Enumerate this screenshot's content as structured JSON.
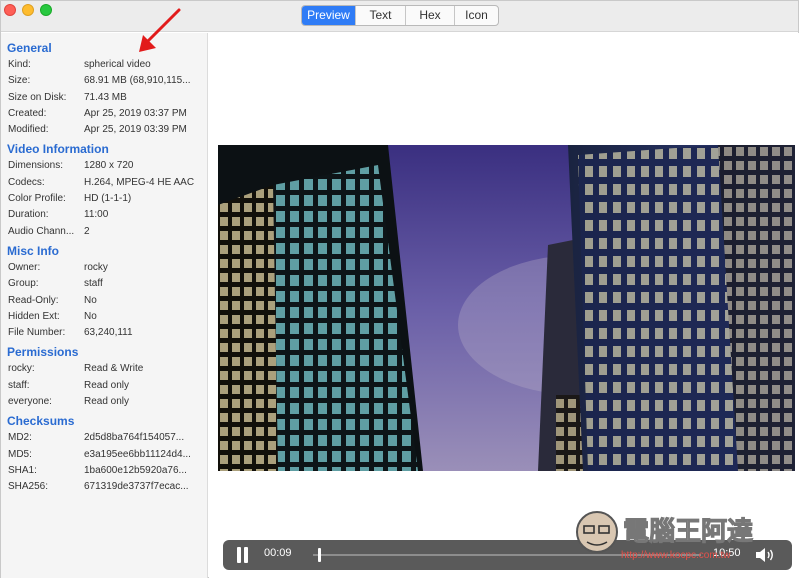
{
  "tabs": [
    {
      "label": "Preview",
      "active": true
    },
    {
      "label": "Text",
      "active": false
    },
    {
      "label": "Hex",
      "active": false
    },
    {
      "label": "Icon",
      "active": false
    }
  ],
  "sections": [
    {
      "title": "General",
      "rows": [
        {
          "k": "Kind:",
          "v": "spherical video"
        },
        {
          "k": "Size:",
          "v": "68.91 MB (68,910,115..."
        },
        {
          "k": "Size on Disk:",
          "v": "71.43 MB"
        },
        {
          "k": "Created:",
          "v": "Apr 25, 2019 03:37 PM"
        },
        {
          "k": "Modified:",
          "v": "Apr 25, 2019 03:39 PM"
        }
      ]
    },
    {
      "title": "Video Information",
      "rows": [
        {
          "k": "Dimensions:",
          "v": "1280 x 720"
        },
        {
          "k": "Codecs:",
          "v": "H.264, MPEG-4 HE AAC"
        },
        {
          "k": "Color Profile:",
          "v": "HD (1-1-1)"
        },
        {
          "k": "Duration:",
          "v": "11:00"
        },
        {
          "k": "Audio Chann...",
          "v": "2"
        }
      ]
    },
    {
      "title": "Misc Info",
      "rows": [
        {
          "k": "Owner:",
          "v": "rocky"
        },
        {
          "k": "Group:",
          "v": "staff"
        },
        {
          "k": "Read-Only:",
          "v": "No"
        },
        {
          "k": "Hidden Ext:",
          "v": "No"
        },
        {
          "k": "File Number:",
          "v": "63,240,111"
        }
      ]
    },
    {
      "title": "Permissions",
      "rows": [
        {
          "k": "rocky:",
          "v": "Read & Write"
        },
        {
          "k": "staff:",
          "v": "Read only"
        },
        {
          "k": "everyone:",
          "v": "Read only"
        }
      ]
    },
    {
      "title": "Checksums",
      "rows": [
        {
          "k": "MD2:",
          "v": "2d5d8ba764f154057..."
        },
        {
          "k": "MD5:",
          "v": "e3a195ee6bb11124d4..."
        },
        {
          "k": "SHA1:",
          "v": "1ba600e12b5920a76..."
        },
        {
          "k": "SHA256:",
          "v": "671319de3737f7ecac..."
        }
      ]
    }
  ],
  "player": {
    "current_time": "00:09",
    "duration": "10:50",
    "progress": 0.014
  },
  "watermark": {
    "text": "電腦王阿達",
    "url": "http://www.kocpc.com.tw"
  },
  "colors": {
    "accent": "#2f7cf6",
    "section_title": "#2a6bd1",
    "annotation_arrow": "#e21b1b"
  }
}
